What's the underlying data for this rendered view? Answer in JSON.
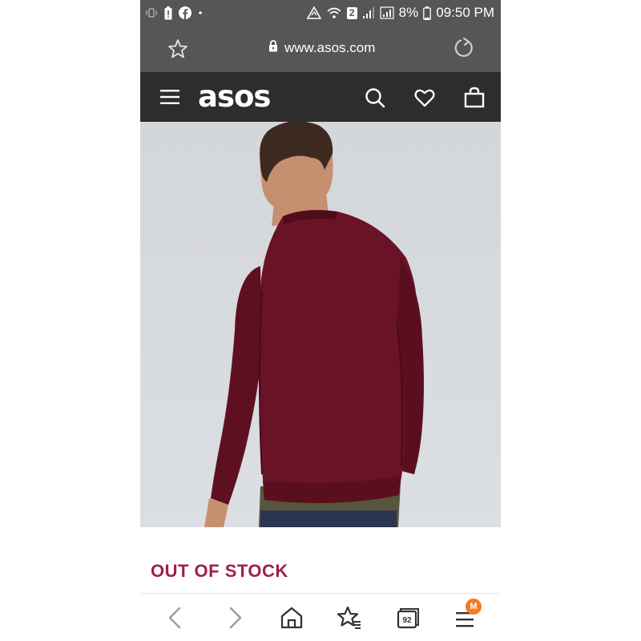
{
  "status_bar": {
    "battery_percent": "8%",
    "time": "09:50 PM",
    "wifi_badge": "2",
    "icons": [
      "vibrate-icon",
      "battery-alert-icon",
      "facebook-icon",
      "dot-icon",
      "sync-icon",
      "wifi-icon",
      "signal-icon",
      "signal-icon",
      "battery-icon"
    ]
  },
  "browser": {
    "url": "www.asos.com"
  },
  "site_header": {
    "logo": "asos",
    "icons": [
      "menu-icon",
      "search-icon",
      "heart-icon",
      "bag-icon"
    ]
  },
  "product": {
    "stock_status": "OUT OF STOCK",
    "image_description_colors": {
      "sweater": "#6a1326",
      "background": "#d8dbde"
    }
  },
  "bottom_nav": {
    "tab_count": "92",
    "menu_badge": "M",
    "icons": [
      "back-icon",
      "forward-icon",
      "home-icon",
      "bookmarks-icon",
      "tabs-icon",
      "menu-icon"
    ]
  },
  "colors": {
    "status_bar_bg": "#565656",
    "header_bg": "#2d2d2d",
    "stock_text": "#a01e4f",
    "badge": "#f47b20"
  }
}
